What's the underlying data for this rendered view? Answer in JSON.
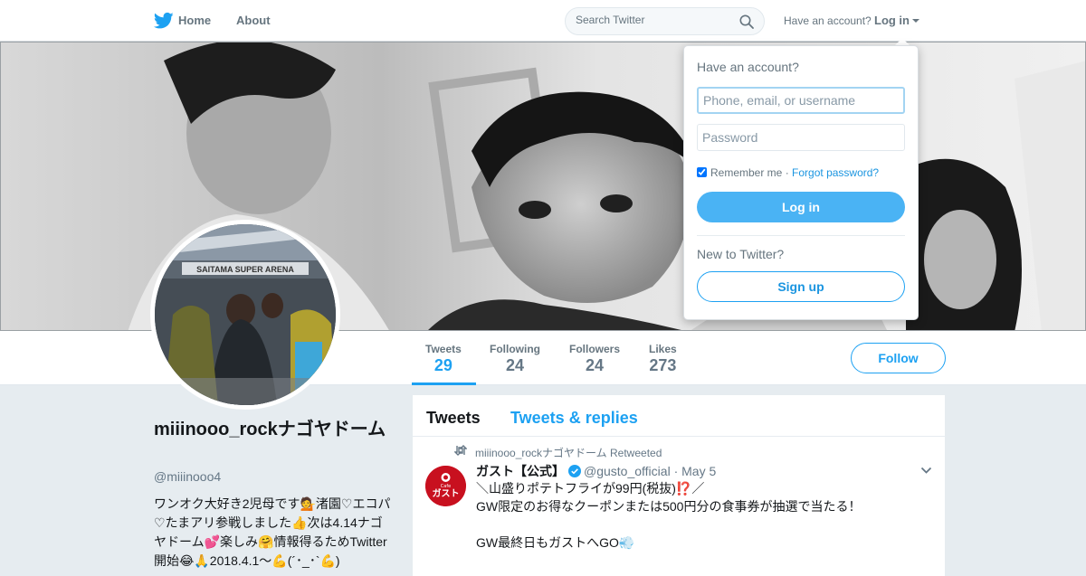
{
  "nav": {
    "home": "Home",
    "about": "About",
    "search_placeholder": "Search Twitter",
    "have_account": "Have an account?",
    "login": "Log in",
    "brand_color": "#1da1f2"
  },
  "profile": {
    "display_name": "miiinooo_rockナゴヤドーム",
    "handle": "@miiinooo4",
    "bio": "ワンオク大好き2児母です💁渚園♡エコパ♡たまアリ参戦しました👍次は4.14ナゴヤドーム💕楽しみ🤗情報得るためTwitter開始😂🙏2018.4.1〜💪(´･_･`💪)",
    "avatar_caption": "SAITAMA SUPER ARENA",
    "follow": "Follow"
  },
  "stats": [
    {
      "label": "Tweets",
      "value": "29"
    },
    {
      "label": "Following",
      "value": "24"
    },
    {
      "label": "Followers",
      "value": "24"
    },
    {
      "label": "Likes",
      "value": "273"
    }
  ],
  "timeline": {
    "tabs": [
      "Tweets",
      "Tweets & replies"
    ],
    "tweet": {
      "context": "miiinooo_rockナゴヤドーム Retweeted",
      "name": "ガスト【公式】",
      "handle": "@gusto_official",
      "dot": "·",
      "date": "May 5",
      "avatar_text_top": "Cafe",
      "avatar_text": "ガスト",
      "text": "＼山盛りポテトフライが99円(税抜)⁉️／\nGW限定のお得なクーポンまたは500円分の食事券が抽選で当たる！\n\nGW最終日もガストへGO💨"
    }
  },
  "login_dropdown": {
    "title": "Have an account?",
    "username_placeholder": "Phone, email, or username",
    "password_placeholder": "Password",
    "remember": "Remember me",
    "separator": "·",
    "forgot": "Forgot password?",
    "login_button": "Log in",
    "new_to": "New to Twitter?",
    "signup_button": "Sign up"
  },
  "icons": [
    "twitter-bird-icon",
    "search-icon",
    "caret-down-icon",
    "retweet-icon",
    "verified-icon",
    "chevron-down-icon"
  ]
}
